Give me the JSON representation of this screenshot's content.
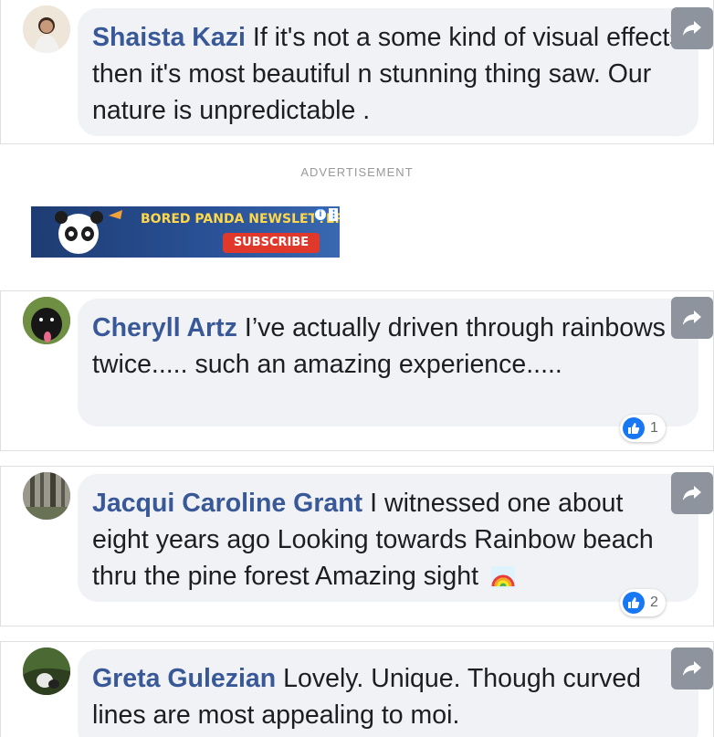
{
  "comments": [
    {
      "author": "Shaista Kazi",
      "text": "If it's not a some kind of visual effects then it's most beautiful n stunning thing saw. Our nature is unpredictable .",
      "reactions": null
    },
    {
      "author": "Cheryll Artz",
      "text": "I’ve actually driven through rainbows twice..... such an amazing experience.....",
      "reactions": "1"
    },
    {
      "author": "Jacqui Caroline Grant",
      "text": "I witnessed one about eight years ago Looking towards Rainbow beach thru the pine forest Amazing sight",
      "reactions": "2"
    },
    {
      "author": "Greta Gulezian",
      "text": "Lovely. Unique. Though curved lines are most appealing to moi.",
      "reactions": null
    }
  ],
  "advertisement": {
    "label": "ADVERTISEMENT",
    "banner_title": "BORED PANDA NEWSLETTER",
    "banner_button": "SUBSCRIBE",
    "info_glyph": "i",
    "menu_glyph": "⋮"
  },
  "icons": {
    "share": "share-arrow-icon",
    "like": "thumbs-up-icon",
    "rainbow": "rainbow-emoji-icon"
  },
  "colors": {
    "author": "#385898",
    "bubble": "#f0f2f5",
    "share_button": "#8d949e",
    "like": "#1877f2"
  }
}
